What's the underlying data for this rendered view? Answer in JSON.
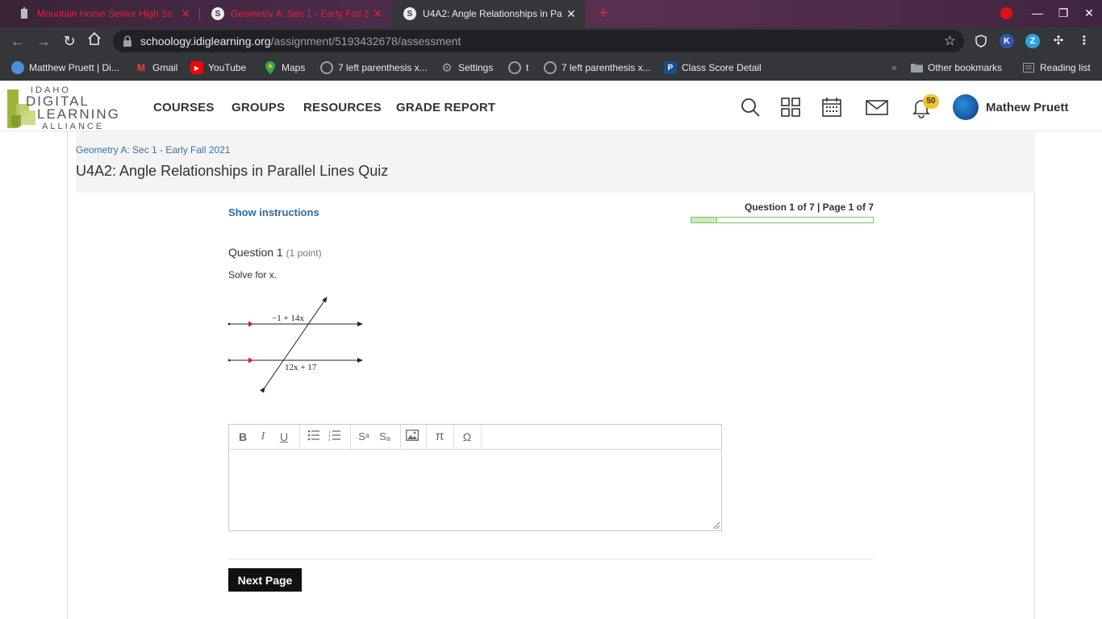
{
  "browser": {
    "tabs": [
      {
        "title": "Mountain Home Senior High Sc",
        "state": "inactive"
      },
      {
        "title": "Geometry A: Sec 1 - Early Fall 2",
        "state": "inactive"
      },
      {
        "title": "U4A2: Angle Relationships in Pa",
        "state": "active"
      }
    ],
    "new_tab_glyph": "+",
    "url_host": "schoology.idiglearning.org",
    "url_path": "/assignment/5193432678/assessment",
    "bookmarks": [
      {
        "label": "Matthew Pruett | Di...",
        "icon": "globe-icon"
      },
      {
        "label": "Gmail",
        "icon": "gmail-icon"
      },
      {
        "label": "YouTube",
        "icon": "youtube-icon"
      },
      {
        "label": "Maps",
        "icon": "maps-icon"
      },
      {
        "label": "7 left parenthesis x...",
        "icon": "globe-icon"
      },
      {
        "label": "Settings",
        "icon": "gear-icon"
      },
      {
        "label": "t",
        "icon": "globe-icon"
      },
      {
        "label": "7 left parenthesis x...",
        "icon": "globe-icon"
      },
      {
        "label": "Class Score Detail",
        "icon": "powerschool-icon"
      }
    ],
    "bookmarks_overflow": "»",
    "other_bookmarks": "Other bookmarks",
    "reading_list": "Reading list"
  },
  "site": {
    "logo_lines": [
      "IDAHO",
      "DIGITAL",
      "LEARNING",
      "ALLIANCE"
    ],
    "nav": [
      "COURSES",
      "GROUPS",
      "RESOURCES",
      "GRADE REPORT"
    ],
    "notification_count": "50",
    "user_name": "Mathew Pruett"
  },
  "page": {
    "course_link": "Geometry A: Sec 1 - Early Fall 2021",
    "title": "U4A2: Angle Relationships in Parallel Lines Quiz",
    "show_instructions": "Show instructions",
    "question_counter": "Question 1 of 7 | Page 1 of 7",
    "progress_fraction": 0.142857,
    "question_label": "Question 1",
    "question_points": "(1 point)",
    "question_text": "Solve for x.",
    "figure": {
      "top_label": "−1 + 14x",
      "bottom_label": "12x + 17"
    },
    "editor_tools": [
      {
        "glyph": "B",
        "name": "bold-button"
      },
      {
        "glyph": "I",
        "name": "italic-button"
      },
      {
        "glyph": "U",
        "name": "underline-button"
      },
      {
        "glyph": "",
        "name": "bullet-list-button"
      },
      {
        "glyph": "",
        "name": "numbered-list-button"
      },
      {
        "glyph": "Sᵃ",
        "name": "superscript-button"
      },
      {
        "glyph": "Sₐ",
        "name": "subscript-button"
      },
      {
        "glyph": "",
        "name": "insert-image-button"
      },
      {
        "glyph": "π",
        "name": "insert-math-button"
      },
      {
        "glyph": "Ω",
        "name": "special-character-button"
      }
    ],
    "next_button": "Next Page"
  },
  "colors": {
    "tab_inactive_text": "#e0233a",
    "chrome_toolbar": "#35363a",
    "link_blue": "#2e6aa3",
    "progress_green": "#7cc468",
    "badge_yellow": "#f2c12e",
    "logo_green": "#9cb53a"
  }
}
